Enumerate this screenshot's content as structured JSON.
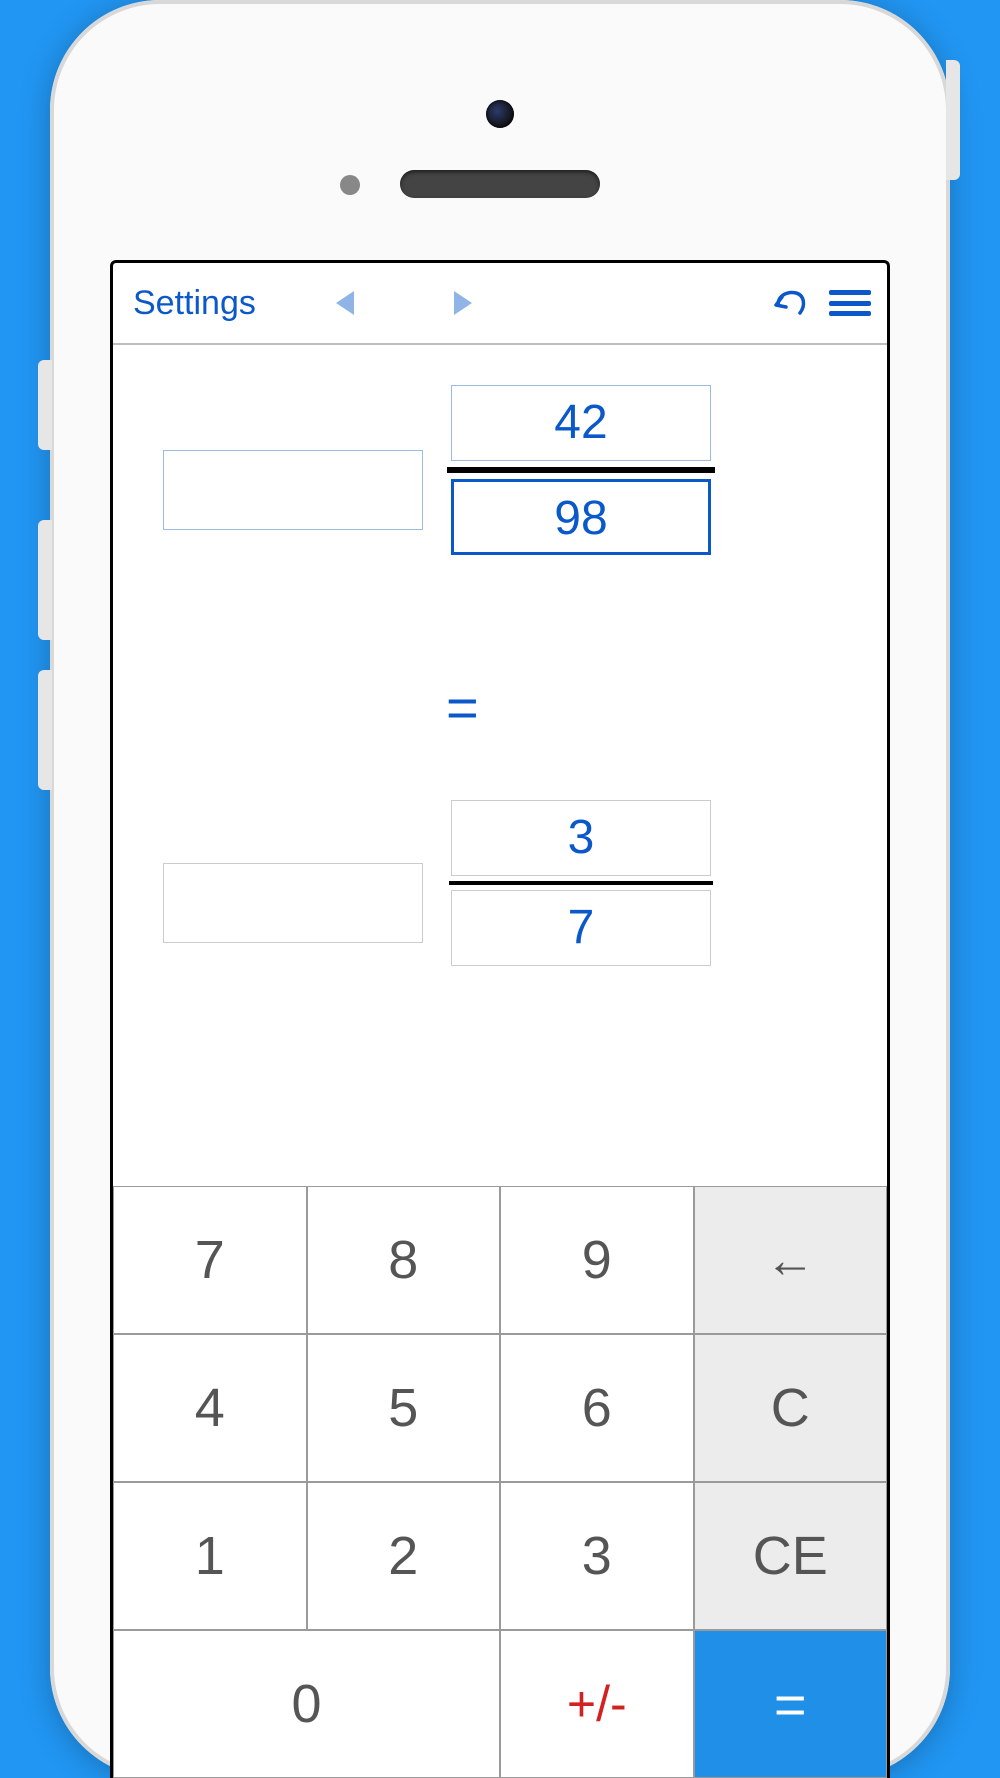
{
  "toolbar": {
    "settings_label": "Settings"
  },
  "input": {
    "whole": "",
    "numerator": "42",
    "denominator": "98",
    "equals": "="
  },
  "result": {
    "whole": "",
    "numerator": "3",
    "denominator": "7"
  },
  "keypad": {
    "k7": "7",
    "k8": "8",
    "k9": "9",
    "backspace": "←",
    "k4": "4",
    "k5": "5",
    "k6": "6",
    "clear": "C",
    "k1": "1",
    "k2": "2",
    "k3": "3",
    "clear_entry": "CE",
    "k0": "0",
    "plus_minus": "+/-",
    "equals": "="
  }
}
